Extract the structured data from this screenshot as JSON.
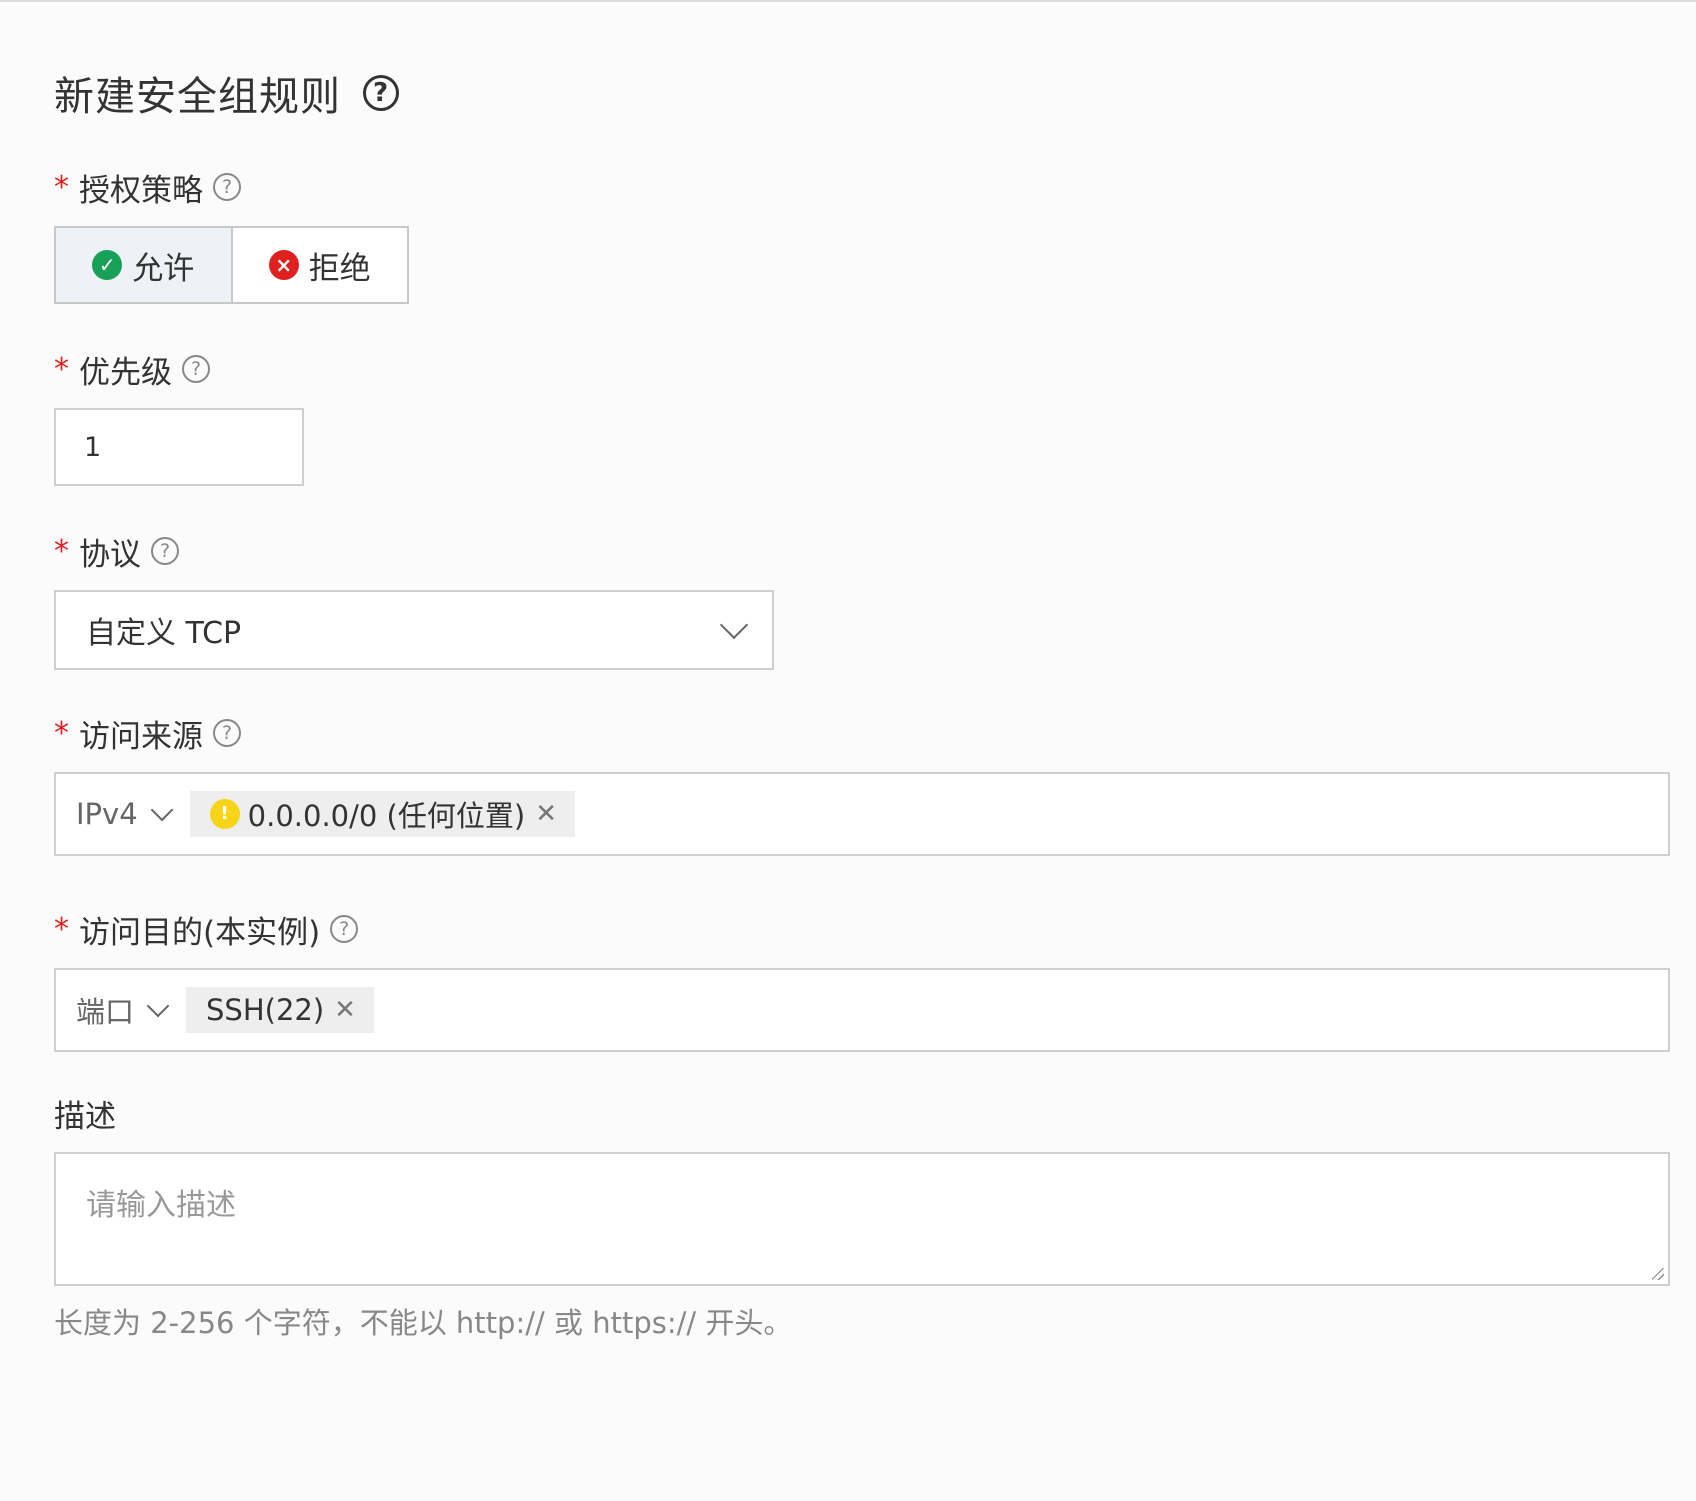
{
  "title": "新建安全组规则",
  "policy": {
    "label": "授权策略",
    "options": [
      "允许",
      "拒绝"
    ],
    "selected": "允许"
  },
  "priority": {
    "label": "优先级",
    "value": "1"
  },
  "protocol": {
    "label": "协议",
    "value": "自定义 TCP"
  },
  "source": {
    "label": "访问来源",
    "type": "IPv4",
    "tag": "0.0.0.0/0 (任何位置)"
  },
  "destination": {
    "label": "访问目的(本实例)",
    "type": "端口",
    "tag": "SSH(22)"
  },
  "description": {
    "label": "描述",
    "placeholder": "请输入描述",
    "hint": "长度为 2-256 个字符，不能以 http:// 或 https:// 开头。"
  },
  "icons": {
    "help": "?",
    "check": "✓",
    "cross": "×",
    "warn": "!",
    "close": "✕"
  },
  "colors": {
    "required": "#e02020",
    "allow": "#18a058",
    "deny": "#e0201e",
    "warning": "#f7d417"
  }
}
